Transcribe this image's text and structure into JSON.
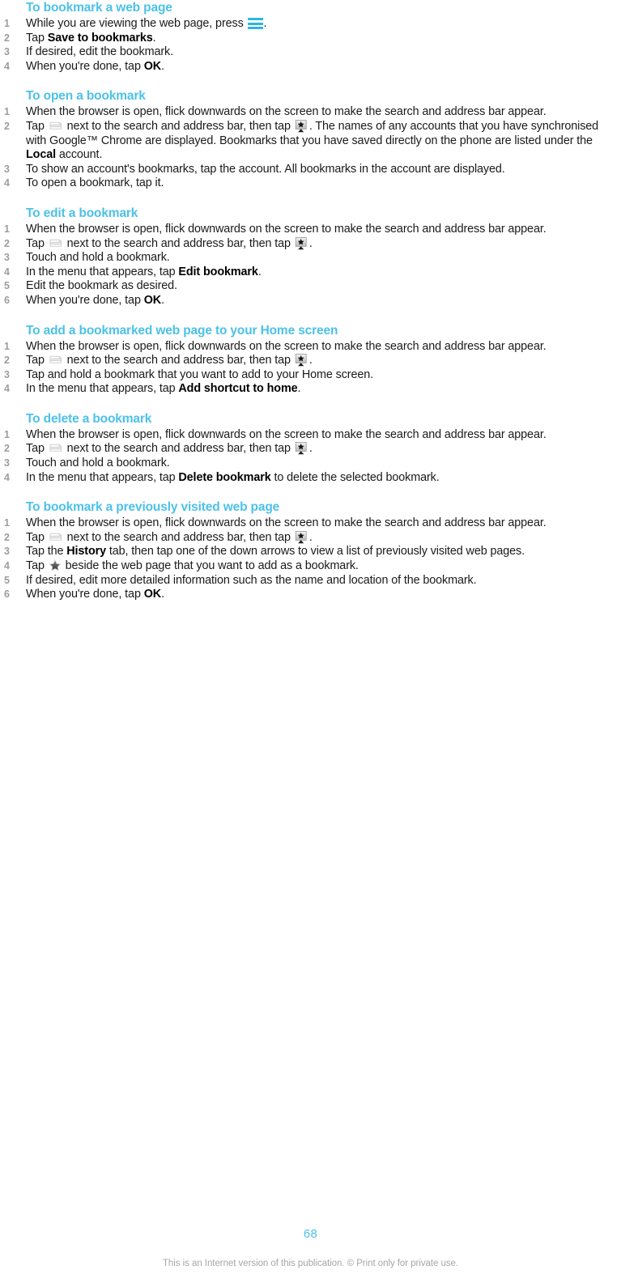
{
  "document": {
    "page_number": "68",
    "footer_text": "This is an Internet version of this publication. © Print only for private use.",
    "heading_color": "#4cc1e9",
    "number_color": "#9d9d9d",
    "body_color": "#1a1a1a"
  },
  "icons": {
    "menu_key": "menu-icon",
    "tabs": "tabs-icon",
    "bookmark_button": "bookmark-star-button-icon",
    "star": "star-icon"
  },
  "sections": [
    {
      "heading": "To bookmark a web page",
      "steps": [
        {
          "num": "1",
          "parts": [
            {
              "t": "text",
              "v": "While you are viewing the web page, press "
            },
            {
              "t": "icon",
              "v": "menu-icon"
            },
            {
              "t": "text",
              "v": "."
            }
          ]
        },
        {
          "num": "2",
          "parts": [
            {
              "t": "text",
              "v": "Tap "
            },
            {
              "t": "bold",
              "v": "Save to bookmarks"
            },
            {
              "t": "text",
              "v": "."
            }
          ]
        },
        {
          "num": "3",
          "parts": [
            {
              "t": "text",
              "v": "If desired, edit the bookmark."
            }
          ]
        },
        {
          "num": "4",
          "parts": [
            {
              "t": "text",
              "v": "When you're done, tap "
            },
            {
              "t": "bold",
              "v": "OK"
            },
            {
              "t": "text",
              "v": "."
            }
          ]
        }
      ]
    },
    {
      "heading": "To open a bookmark",
      "steps": [
        {
          "num": "1",
          "parts": [
            {
              "t": "text",
              "v": "When the browser is open, flick downwards on the screen to make the search and address bar appear."
            }
          ]
        },
        {
          "num": "2",
          "parts": [
            {
              "t": "text",
              "v": "Tap "
            },
            {
              "t": "icon",
              "v": "tabs-icon"
            },
            {
              "t": "text",
              "v": " next to the search and address bar, then tap "
            },
            {
              "t": "icon",
              "v": "bookmark-star-button-icon"
            },
            {
              "t": "text",
              "v": ". The names of any accounts that you have synchronised with Google™ Chrome are displayed. Bookmarks that you have saved directly on the phone are listed under the "
            },
            {
              "t": "bold",
              "v": "Local"
            },
            {
              "t": "text",
              "v": " account."
            }
          ]
        },
        {
          "num": "3",
          "parts": [
            {
              "t": "text",
              "v": "To show an account's bookmarks, tap the account. All bookmarks in the account are displayed."
            }
          ]
        },
        {
          "num": "4",
          "parts": [
            {
              "t": "text",
              "v": "To open a bookmark, tap it."
            }
          ]
        }
      ]
    },
    {
      "heading": "To edit a bookmark",
      "steps": [
        {
          "num": "1",
          "parts": [
            {
              "t": "text",
              "v": "When the browser is open, flick downwards on the screen to make the search and address bar appear."
            }
          ]
        },
        {
          "num": "2",
          "parts": [
            {
              "t": "text",
              "v": "Tap "
            },
            {
              "t": "icon",
              "v": "tabs-icon"
            },
            {
              "t": "text",
              "v": " next to the search and address bar, then tap "
            },
            {
              "t": "icon",
              "v": "bookmark-star-button-icon"
            },
            {
              "t": "text",
              "v": "."
            }
          ]
        },
        {
          "num": "3",
          "parts": [
            {
              "t": "text",
              "v": "Touch and hold a bookmark."
            }
          ]
        },
        {
          "num": "4",
          "parts": [
            {
              "t": "text",
              "v": "In the menu that appears, tap "
            },
            {
              "t": "bold",
              "v": "Edit bookmark"
            },
            {
              "t": "text",
              "v": "."
            }
          ]
        },
        {
          "num": "5",
          "parts": [
            {
              "t": "text",
              "v": "Edit the bookmark as desired."
            }
          ]
        },
        {
          "num": "6",
          "parts": [
            {
              "t": "text",
              "v": "When you're done, tap "
            },
            {
              "t": "bold",
              "v": "OK"
            },
            {
              "t": "text",
              "v": "."
            }
          ]
        }
      ]
    },
    {
      "heading": "To add a bookmarked web page to your Home screen",
      "steps": [
        {
          "num": "1",
          "parts": [
            {
              "t": "text",
              "v": "When the browser is open, flick downwards on the screen to make the search and address bar appear."
            }
          ]
        },
        {
          "num": "2",
          "parts": [
            {
              "t": "text",
              "v": "Tap "
            },
            {
              "t": "icon",
              "v": "tabs-icon"
            },
            {
              "t": "text",
              "v": " next to the search and address bar, then tap "
            },
            {
              "t": "icon",
              "v": "bookmark-star-button-icon"
            },
            {
              "t": "text",
              "v": "."
            }
          ]
        },
        {
          "num": "3",
          "parts": [
            {
              "t": "text",
              "v": "Tap and hold a bookmark that you want to add to your Home screen."
            }
          ]
        },
        {
          "num": "4",
          "parts": [
            {
              "t": "text",
              "v": "In the menu that appears, tap "
            },
            {
              "t": "bold",
              "v": "Add shortcut to home"
            },
            {
              "t": "text",
              "v": "."
            }
          ]
        }
      ]
    },
    {
      "heading": "To delete a bookmark",
      "steps": [
        {
          "num": "1",
          "parts": [
            {
              "t": "text",
              "v": "When the browser is open, flick downwards on the screen to make the search and address bar appear."
            }
          ]
        },
        {
          "num": "2",
          "parts": [
            {
              "t": "text",
              "v": "Tap "
            },
            {
              "t": "icon",
              "v": "tabs-icon"
            },
            {
              "t": "text",
              "v": " next to the search and address bar, then tap "
            },
            {
              "t": "icon",
              "v": "bookmark-star-button-icon"
            },
            {
              "t": "text",
              "v": "."
            }
          ]
        },
        {
          "num": "3",
          "parts": [
            {
              "t": "text",
              "v": "Touch and hold a bookmark."
            }
          ]
        },
        {
          "num": "4",
          "parts": [
            {
              "t": "text",
              "v": "In the menu that appears, tap "
            },
            {
              "t": "bold",
              "v": "Delete bookmark"
            },
            {
              "t": "text",
              "v": " to delete the selected bookmark."
            }
          ]
        }
      ]
    },
    {
      "heading": "To bookmark a previously visited web page",
      "steps": [
        {
          "num": "1",
          "parts": [
            {
              "t": "text",
              "v": "When the browser is open, flick downwards on the screen to make the search and address bar appear."
            }
          ]
        },
        {
          "num": "2",
          "parts": [
            {
              "t": "text",
              "v": "Tap "
            },
            {
              "t": "icon",
              "v": "tabs-icon"
            },
            {
              "t": "text",
              "v": " next to the search and address bar, then tap "
            },
            {
              "t": "icon",
              "v": "bookmark-star-button-icon"
            },
            {
              "t": "text",
              "v": "."
            }
          ]
        },
        {
          "num": "3",
          "parts": [
            {
              "t": "text",
              "v": "Tap the "
            },
            {
              "t": "bold",
              "v": "History"
            },
            {
              "t": "text",
              "v": " tab, then tap one of the down arrows to view a list of previously visited web pages."
            }
          ]
        },
        {
          "num": "4",
          "parts": [
            {
              "t": "text",
              "v": "Tap "
            },
            {
              "t": "icon",
              "v": "star-icon"
            },
            {
              "t": "text",
              "v": " beside the web page that you want to add as a bookmark."
            }
          ]
        },
        {
          "num": "5",
          "parts": [
            {
              "t": "text",
              "v": "If desired, edit more detailed information such as the name and location of the bookmark."
            }
          ]
        },
        {
          "num": "6",
          "parts": [
            {
              "t": "text",
              "v": "When you're done, tap "
            },
            {
              "t": "bold",
              "v": "OK"
            },
            {
              "t": "text",
              "v": "."
            }
          ]
        }
      ]
    }
  ]
}
